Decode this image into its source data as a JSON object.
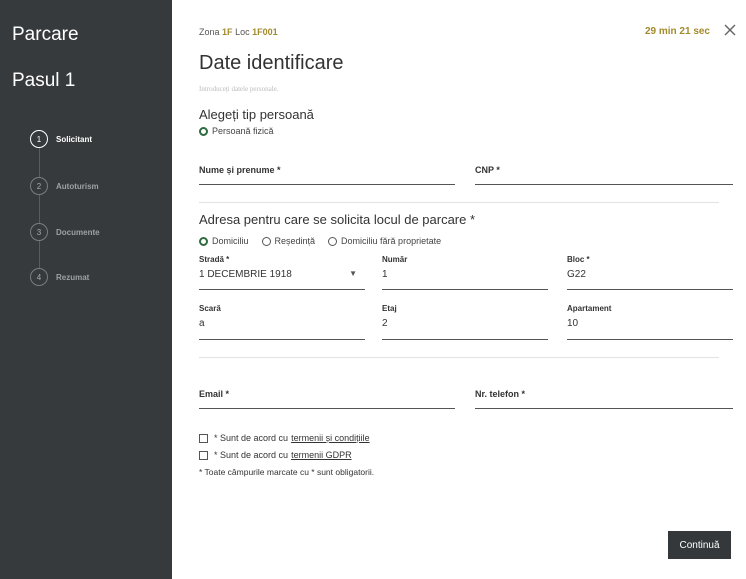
{
  "sidebar": {
    "title": "Parcare",
    "step_title": "Pasul 1",
    "steps": [
      {
        "num": "1",
        "label": "Solicitant"
      },
      {
        "num": "2",
        "label": "Autoturism"
      },
      {
        "num": "3",
        "label": "Documente"
      },
      {
        "num": "4",
        "label": "Rezumat"
      }
    ]
  },
  "header": {
    "zone_prefix": "Zona",
    "zone": "1F",
    "loc_prefix": "Loc",
    "loc": "1F001",
    "timer": "29 min 21 sec"
  },
  "form": {
    "title": "Date identificare",
    "subtitle": "Introduceți datele personale.",
    "person_type_label": "Alegeți tip persoană",
    "person_type_option": "Persoană fizică",
    "name_label": "Nume și prenume *",
    "cnp_label": "CNP *",
    "address_label": "Adresa pentru care se solicita locul de parcare *",
    "address_options": [
      "Domiciliu",
      "Reședință",
      "Domiciliu fără proprietate"
    ],
    "street_label": "Stradă *",
    "street_value": "1 DECEMBRIE 1918",
    "number_label": "Număr",
    "number_value": "1",
    "block_label": "Bloc *",
    "block_value": "G22",
    "stair_label": "Scară",
    "stair_value": "a",
    "floor_label": "Etaj",
    "floor_value": "2",
    "apt_label": "Apartament",
    "apt_value": "10",
    "email_label": "Email *",
    "phone_label": "Nr. telefon *",
    "terms_text": "* Sunt de acord cu",
    "terms_link": "termenii și condițiile",
    "gdpr_text": "* Sunt de acord cu",
    "gdpr_link": "termenii GDPR",
    "note": "* Toate câmpurile marcate cu * sunt obligatorii.",
    "continue_label": "Continuă"
  },
  "colors": {
    "sidebar": "#373a3d",
    "accent": "#a38a2c",
    "radio": "#2e6b3e"
  }
}
